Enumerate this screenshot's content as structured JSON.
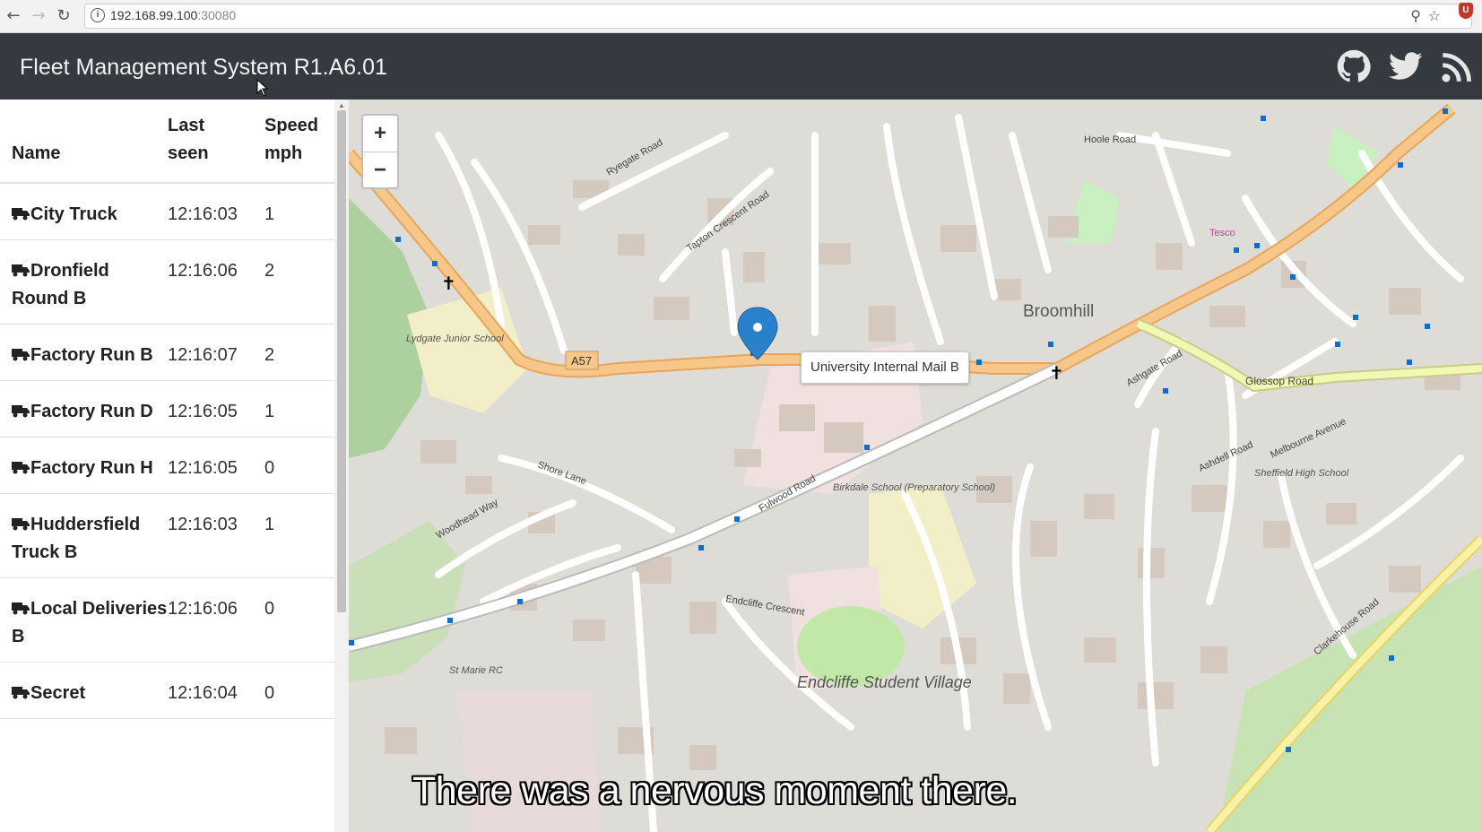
{
  "browser": {
    "url_host": "192.168.99.100",
    "url_port": ":30080"
  },
  "header": {
    "title": "Fleet Management System R1.A6.01",
    "icons": [
      "github-icon",
      "twitter-icon",
      "rss-icon"
    ]
  },
  "table": {
    "headers": {
      "name": "Name",
      "last_seen": "Last seen",
      "speed": "Speed mph"
    },
    "rows": [
      {
        "name": "City Truck",
        "last_seen": "12:16:03",
        "speed": "1"
      },
      {
        "name": "Dronfield Round B",
        "last_seen": "12:16:06",
        "speed": "2"
      },
      {
        "name": "Factory Run B",
        "last_seen": "12:16:07",
        "speed": "2"
      },
      {
        "name": "Factory Run D",
        "last_seen": "12:16:05",
        "speed": "1"
      },
      {
        "name": "Factory Run H",
        "last_seen": "12:16:05",
        "speed": "0"
      },
      {
        "name": "Huddersfield Truck B",
        "last_seen": "12:16:03",
        "speed": "1"
      },
      {
        "name": "Local Deliveries B",
        "last_seen": "12:16:06",
        "speed": "0"
      },
      {
        "name": "Secret",
        "last_seen": "12:16:04",
        "speed": "0"
      }
    ]
  },
  "map": {
    "zoom_in": "+",
    "zoom_out": "−",
    "popup": "University Internal Mail B",
    "labels": {
      "broomhill": "Broomhill",
      "a57": "A57",
      "fulwood_road": "Fulwood Road",
      "glossop_road": "Glossop Road",
      "lydgate": "Lydgate Junior School",
      "birkdale": "Birkdale School (Preparatory School)",
      "endcliffe": "Endcliffe Student Village",
      "tesco": "Tesco",
      "shore_lane": "Shore Lane",
      "woodhead_way": "Woodhead Way",
      "tapton_crescent": "Tapton Crescent Road",
      "ryegate": "Ryegate Road",
      "hoole": "Hoole Road",
      "ashgate": "Ashgate Road",
      "ashdell": "Ashdell Road",
      "endcliffe_crescent": "Endcliffe Crescent",
      "sheffield_high": "Sheffield High School",
      "melbourne": "Melbourne Avenue",
      "clarkehouse": "Clarkehouse Road",
      "st_marie": "St Marie RC"
    },
    "colors": {
      "primary_road": "#f7c78a",
      "secondary_road": "#f3f7b4",
      "marker": "#2a81cb"
    }
  },
  "subtitle": "There was a nervous moment there."
}
